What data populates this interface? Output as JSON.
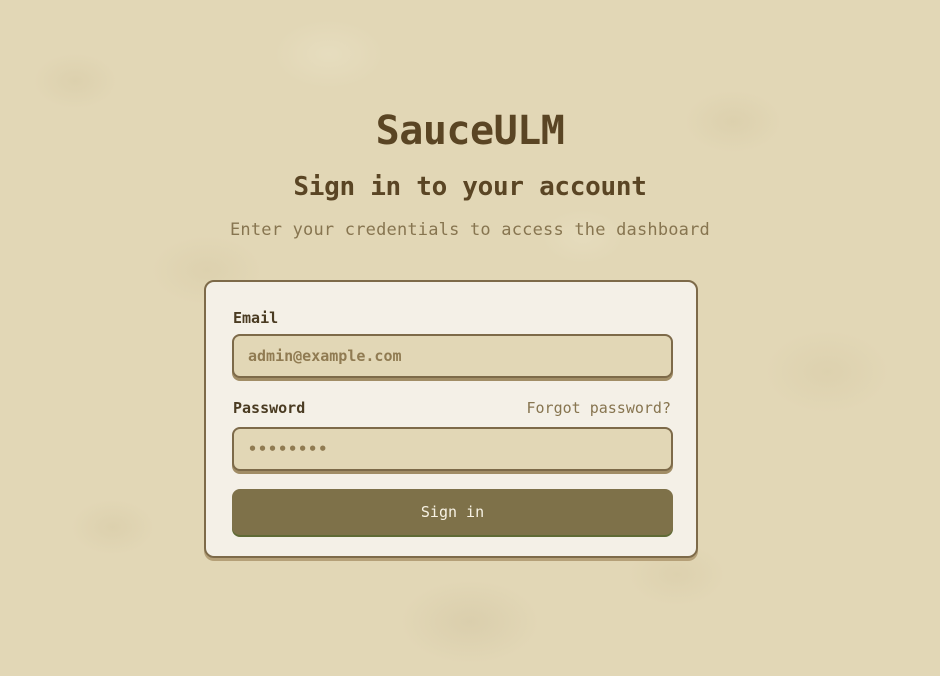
{
  "brand": {
    "name": "SauceULM"
  },
  "header": {
    "title": "Sign in to your account",
    "subtitle": "Enter your credentials to access the dashboard"
  },
  "form": {
    "email": {
      "label": "Email",
      "placeholder": "admin@example.com",
      "value": ""
    },
    "password": {
      "label": "Password",
      "value": "password",
      "forgot_link": "Forgot password?"
    },
    "submit_label": "Sign in"
  },
  "colors": {
    "background": "#e2d7b6",
    "text_primary": "#5a4524",
    "text_muted": "#877550",
    "card_border": "#7d6a49",
    "button": "#7e7149"
  }
}
